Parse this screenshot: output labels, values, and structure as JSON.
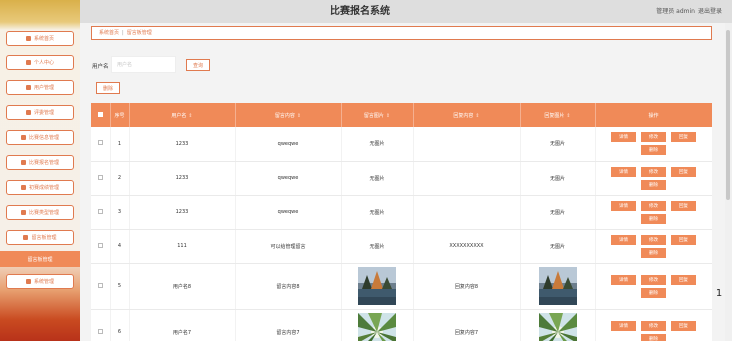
{
  "header": {
    "title": "比赛报名系统",
    "user_role": "管理员 admin",
    "logout": "退出登录"
  },
  "sidebar": {
    "items": [
      {
        "label": "系统首页",
        "icon": "home-icon"
      },
      {
        "label": "个人中心",
        "icon": "user-icon"
      },
      {
        "label": "用户管理",
        "icon": "grid-icon"
      },
      {
        "label": "评委管理",
        "icon": "briefcase-icon"
      },
      {
        "label": "比赛信息管理",
        "icon": "send-icon"
      },
      {
        "label": "比赛报名管理",
        "icon": "grid-icon"
      },
      {
        "label": "初赛成绩管理",
        "icon": "grid-icon"
      },
      {
        "label": "比赛类型管理",
        "icon": "list-icon"
      },
      {
        "label": "留言板管理",
        "icon": "list-icon"
      },
      {
        "label": "留言板管理",
        "icon": "none",
        "active": true
      },
      {
        "label": "系统管理",
        "icon": "monitor-icon"
      }
    ]
  },
  "breadcrumb": {
    "home": "系统首页",
    "separator": "|",
    "current": "留言板管理"
  },
  "search": {
    "label": "用户名",
    "placeholder": "用户名",
    "value": "",
    "button": "查询"
  },
  "toolbar": {
    "delete": "删除"
  },
  "table": {
    "columns": [
      "序号",
      "用户名",
      "留言内容",
      "留言图片",
      "回复内容",
      "回复图片",
      "操作"
    ],
    "actions": [
      "详情",
      "修改",
      "回复",
      "删除"
    ],
    "rows": [
      {
        "index": "1",
        "username": "1233",
        "content": "qweqwe",
        "image": "无图片",
        "reply": "",
        "reply_image": "无图片"
      },
      {
        "index": "2",
        "username": "1233",
        "content": "qweqwe",
        "image": "无图片",
        "reply": "",
        "reply_image": "无图片"
      },
      {
        "index": "3",
        "username": "1233",
        "content": "qweqwe",
        "image": "无图片",
        "reply": "",
        "reply_image": "无图片"
      },
      {
        "index": "4",
        "username": "111",
        "content": "可以给管理留言",
        "image": "无图片",
        "reply": "XXXXXXXXXX",
        "reply_image": "无图片"
      },
      {
        "index": "5",
        "username": "用户名8",
        "content": "留言内容8",
        "image": "landscape-photo",
        "reply": "回复内容8",
        "reply_image": "landscape-photo"
      },
      {
        "index": "6",
        "username": "用户名7",
        "content": "留言内容7",
        "image": "forest-photo",
        "reply": "回复内容7",
        "reply_image": "forest-photo"
      }
    ]
  },
  "colors": {
    "accent": "#f08a58",
    "accent_border": "#e07a4f",
    "header_bg": "#dedede"
  },
  "floating": {
    "glyph": "1"
  }
}
